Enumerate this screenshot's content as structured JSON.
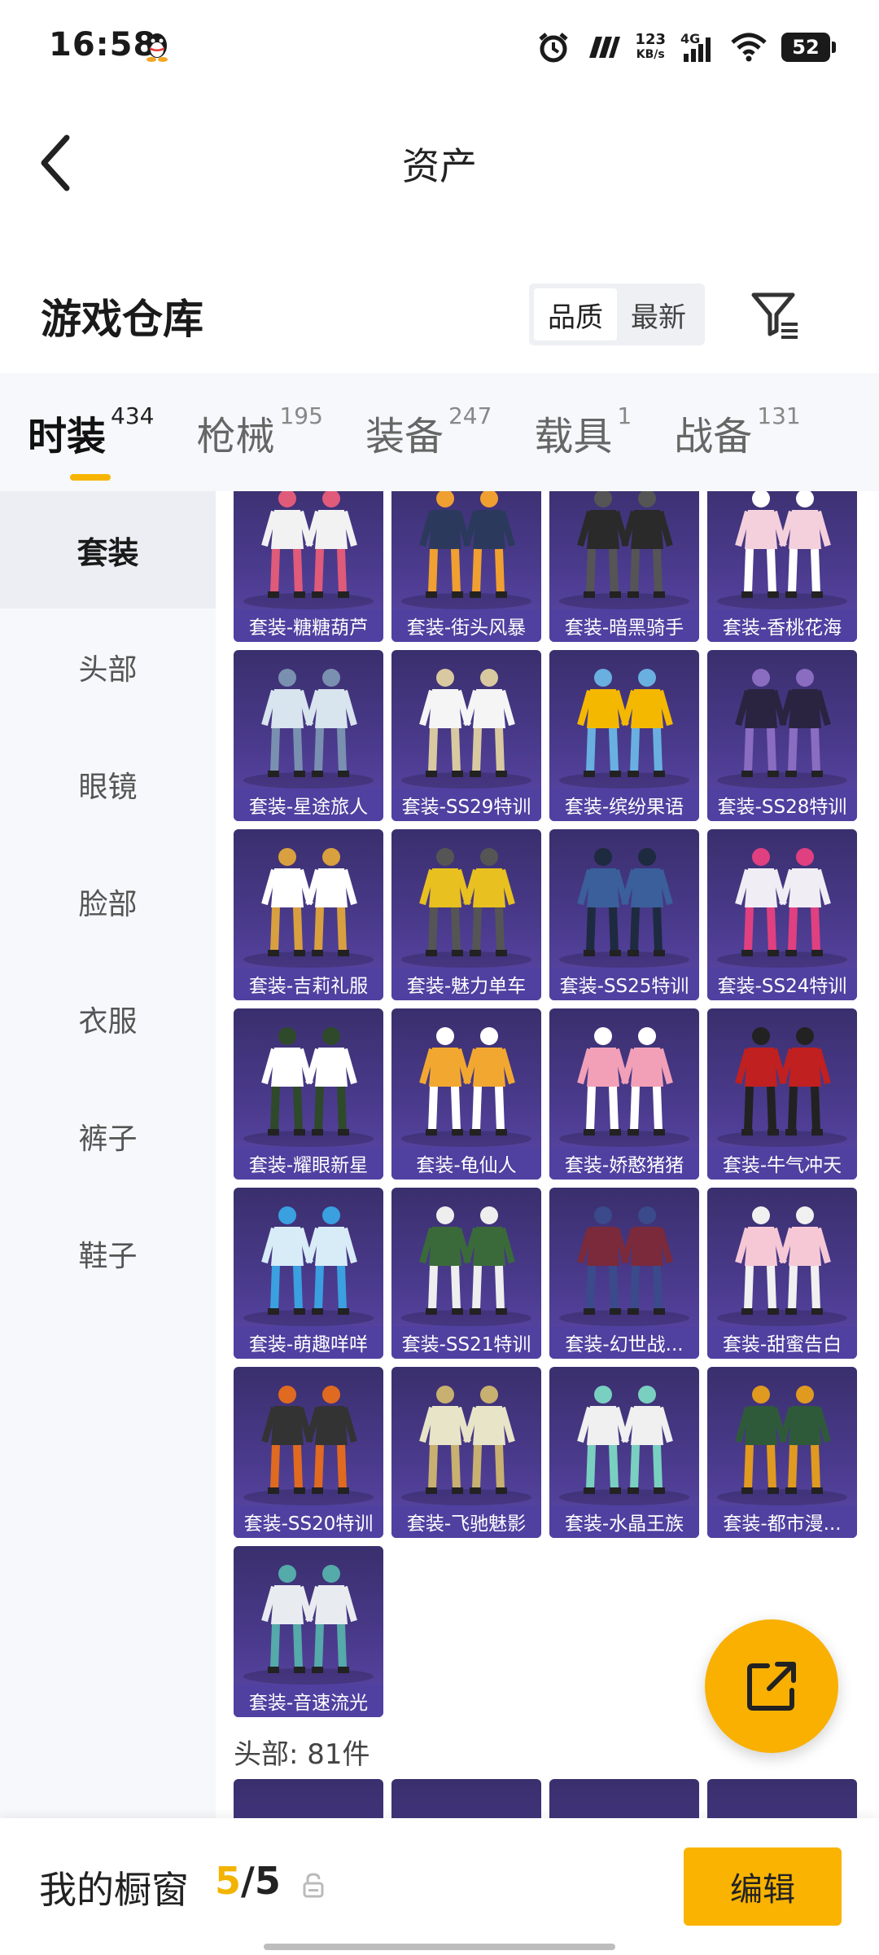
{
  "status": {
    "time": "16:58",
    "net_speed_value": "123",
    "net_speed_unit": "KB/s",
    "network_type": "4G",
    "battery": "52"
  },
  "header": {
    "title": "资产"
  },
  "warehouse": {
    "title": "游戏仓库",
    "sort_options": [
      "品质",
      "最新"
    ],
    "sort_selected": "品质"
  },
  "categories": [
    {
      "label": "时装",
      "count": "434",
      "active": true
    },
    {
      "label": "枪械",
      "count": "195"
    },
    {
      "label": "装备",
      "count": "247"
    },
    {
      "label": "载具",
      "count": "1"
    },
    {
      "label": "战备",
      "count": "131"
    }
  ],
  "sidebar": {
    "items": [
      "套装",
      "头部",
      "眼镜",
      "脸部",
      "衣服",
      "裤子",
      "鞋子"
    ],
    "selected": "套装"
  },
  "items": [
    "套装-糖糖葫芦",
    "套装-街头风暴",
    "套装-暗黑骑手",
    "套装-香桃花海",
    "套装-星途旅人",
    "套装-SS29特训",
    "套装-缤纷果语",
    "套装-SS28特训",
    "套装-吉莉礼服",
    "套装-魅力单车",
    "套装-SS25特训",
    "套装-SS24特训",
    "套装-耀眼新星",
    "套装-龟仙人",
    "套装-娇憨猪猪",
    "套装-牛气冲天",
    "套装-萌趣咩咩",
    "套装-SS21特训",
    "套装-幻世战...",
    "套装-甜蜜告白",
    "套装-SS20特训",
    "套装-飞驰魅影",
    "套装-水晶王族",
    "套装-都市漫...",
    "套装-音速流光"
  ],
  "next_section_label": "头部: 81件",
  "bottom": {
    "showcase_label": "我的橱窗",
    "showcase_current": "5",
    "showcase_sep": "/",
    "showcase_total": "5",
    "edit_label": "编辑"
  },
  "colors": {
    "accent": "#f9b300",
    "card_bg": "#4a3a8c",
    "card_label_bg": "#5040a0"
  }
}
